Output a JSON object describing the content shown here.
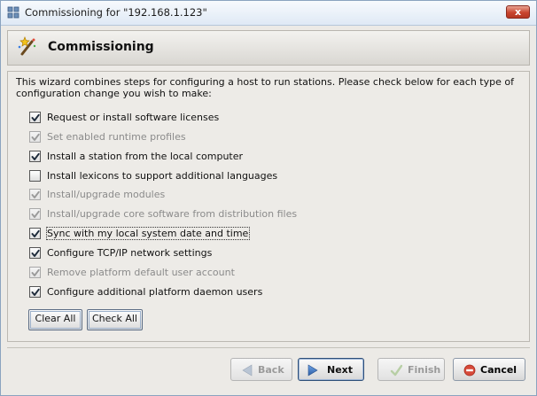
{
  "window": {
    "title": "Commissioning for \"192.168.1.123\"",
    "close_label": "x"
  },
  "header": {
    "title": "Commissioning"
  },
  "description": "This wizard combines steps for configuring a host to run stations. Please check below for each type of configuration change you wish to make:",
  "options": [
    {
      "label": "Request or install software licenses",
      "checked": true,
      "enabled": true
    },
    {
      "label": "Set enabled runtime profiles",
      "checked": true,
      "enabled": false
    },
    {
      "label": "Install a station from the local computer",
      "checked": true,
      "enabled": true
    },
    {
      "label": "Install lexicons to support additional languages",
      "checked": false,
      "enabled": true
    },
    {
      "label": "Install/upgrade modules",
      "checked": true,
      "enabled": false
    },
    {
      "label": "Install/upgrade core software from distribution files",
      "checked": true,
      "enabled": false
    },
    {
      "label": "Sync with my local system date and time",
      "checked": true,
      "enabled": true,
      "focused": true
    },
    {
      "label": "Configure TCP/IP network settings",
      "checked": true,
      "enabled": true
    },
    {
      "label": "Remove platform default user account",
      "checked": true,
      "enabled": false
    },
    {
      "label": "Configure additional platform daemon users",
      "checked": true,
      "enabled": true
    }
  ],
  "actions": {
    "clear_all": "Clear All",
    "check_all": "Check All"
  },
  "wizard": {
    "back": {
      "label": "Back",
      "enabled": false
    },
    "next": {
      "label": "Next",
      "enabled": true
    },
    "finish": {
      "label": "Finish",
      "enabled": false
    },
    "cancel": {
      "label": "Cancel",
      "enabled": true
    }
  },
  "colors": {
    "accent": "#3a6fb0",
    "cancel_red": "#d23a2a",
    "check_green": "#7bb04a"
  }
}
